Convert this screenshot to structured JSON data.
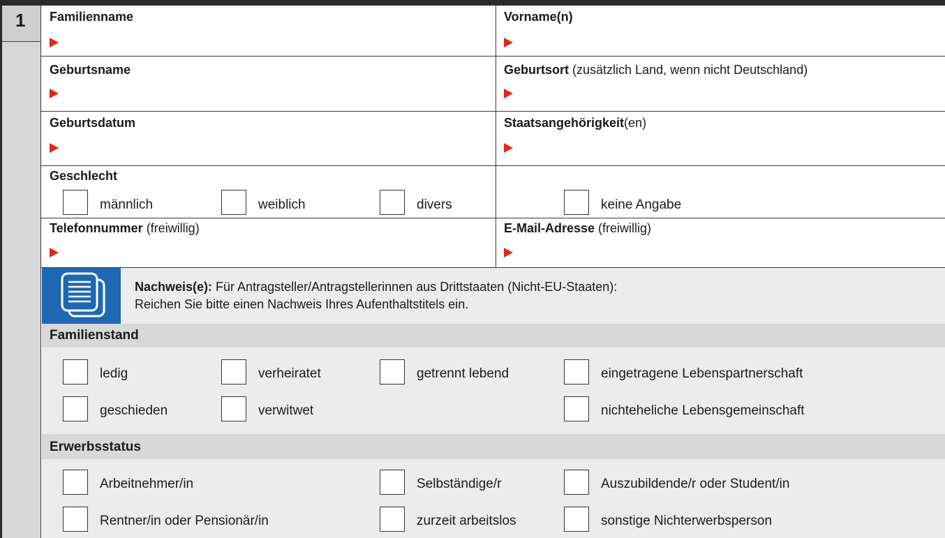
{
  "section_number": "1",
  "fields": {
    "familienname": "Familienname",
    "vornamen": "Vorname(n)",
    "geburtsname": "Geburtsname",
    "geburtsort_bold": "Geburtsort",
    "geburtsort_hint": " (zusätzlich Land, wenn nicht Deutschland)",
    "geburtsdatum": "Geburtsdatum",
    "staat_bold": "Staatsangehörigkeit",
    "staat_suffix": "(en)",
    "telefon_bold": "Telefonnummer",
    "telefon_hint": " (freiwillig)",
    "email_bold": "E-Mail-Adresse",
    "email_hint": " (freiwillig)"
  },
  "geschlecht": {
    "title": "Geschlecht",
    "options": [
      "männlich",
      "weiblich",
      "divers",
      "keine Angabe"
    ]
  },
  "nachweis": {
    "bold": "Nachweis(e):",
    "line1": " Für Antragsteller/Antragstellerinnen aus Drittstaaten (Nicht-EU-Staaten):",
    "line2": "Reichen Sie bitte einen Nachweis Ihres Aufenthaltstitels ein.",
    "icon_color": "#1f68b3"
  },
  "familienstand": {
    "title": "Familienstand",
    "options": [
      "ledig",
      "verheiratet",
      "getrennt lebend",
      "eingetragene Lebenspartnerschaft",
      "geschieden",
      "verwitwet",
      "nichteheliche Lebensgemeinschaft"
    ]
  },
  "erwerbsstatus": {
    "title": "Erwerbsstatus",
    "options": [
      "Arbeitnehmer/in",
      "Selbständige/r",
      "Auszubildende/r oder Student/in",
      "Rentner/in oder Pensionär/in",
      "zurzeit arbeitslos",
      "sonstige Nichterwerbsperson"
    ]
  },
  "colors": {
    "header_bar": "#2b2b2b",
    "section_band": "#d8d8d8",
    "panel_gray": "#ececec",
    "arrow_red": "#e3261b",
    "nachweis_blue": "#1f68b3"
  }
}
